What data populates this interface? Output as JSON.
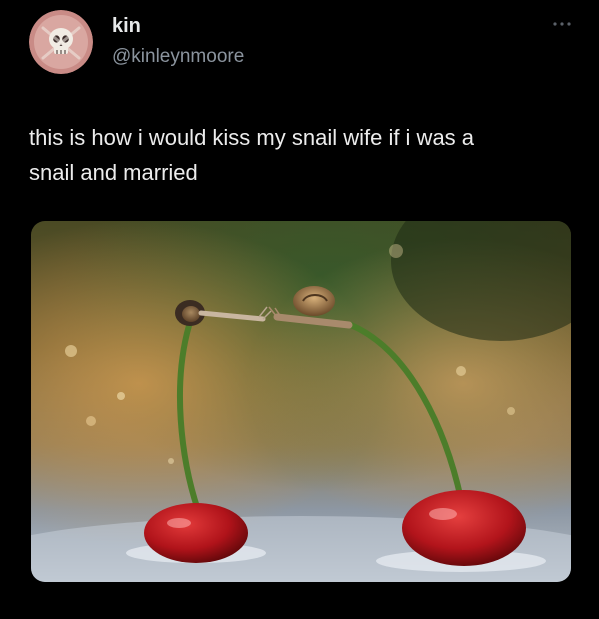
{
  "tweet": {
    "author": {
      "display_name": "kin",
      "handle": "@kinleynmoore",
      "avatar_icon": "skull-avatar-icon"
    },
    "more_icon": "more-horizontal-icon",
    "text": "this is how i would kiss my snail wife if i was a\nsnail and married",
    "media": {
      "icon": "photo-snails-on-cherries",
      "alt": ""
    }
  },
  "colors": {
    "background": "#000000",
    "text": "#e7e9ea",
    "secondary_text": "#8b949e",
    "avatar_bg": "#c98b86"
  }
}
